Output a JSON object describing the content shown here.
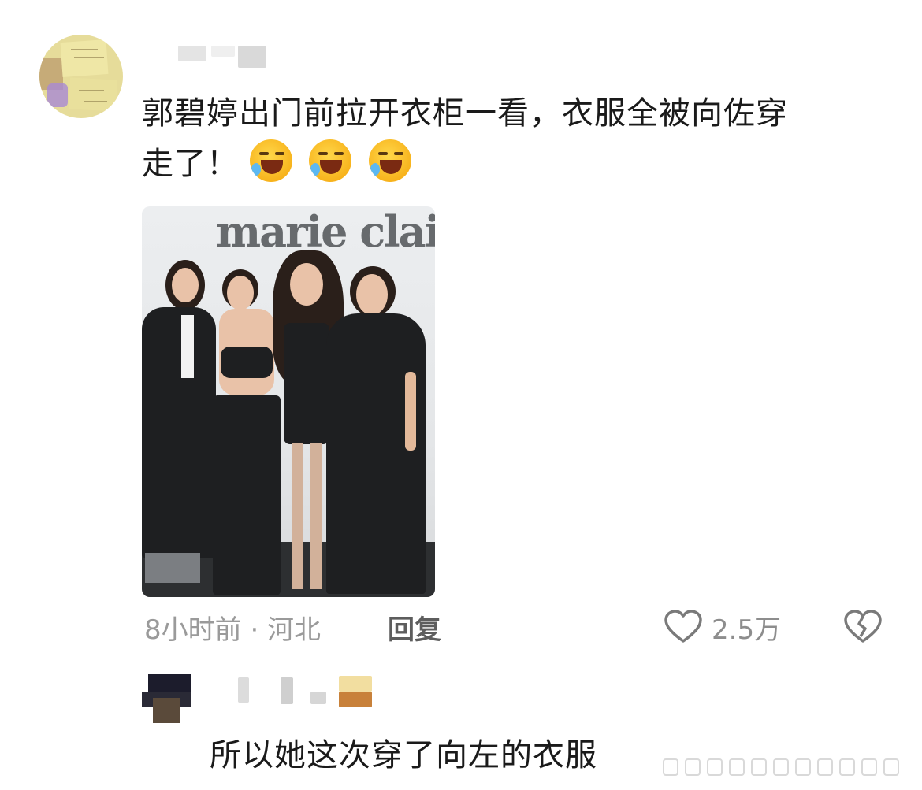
{
  "comment": {
    "text_line1": "郭碧婷出门前拉开衣柜一看，衣服全被向佐穿",
    "text_line2": "走了！",
    "emoji_icon": "face-with-tears-of-joy",
    "emoji_count": 3,
    "photo": {
      "brand_text": "marie clai"
    },
    "meta": "8小时前 · 河北",
    "reply_label": "回复",
    "likes": "2.5万"
  },
  "reply": {
    "text": "所以她这次穿了向左的衣服"
  },
  "colors": {
    "text": "#1a1a1a",
    "meta": "#9a9a9a",
    "icon": "#7a7a7a"
  }
}
